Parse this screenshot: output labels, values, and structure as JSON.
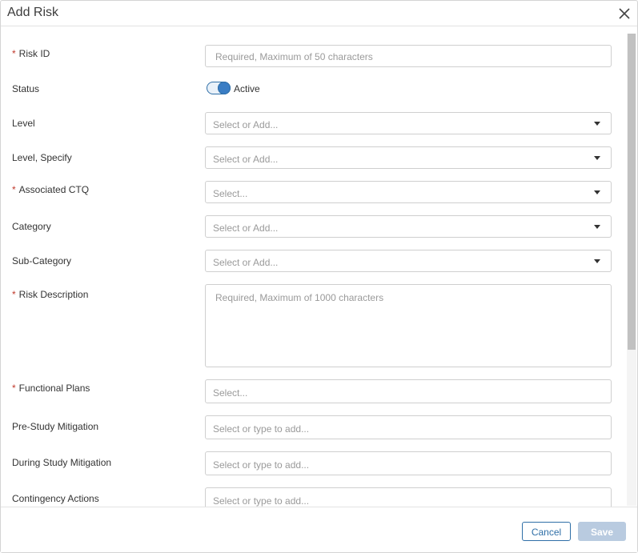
{
  "dialog": {
    "title": "Add Risk"
  },
  "form": {
    "risk_id": {
      "label": "Risk ID",
      "placeholder": "Required, Maximum of 50 characters"
    },
    "status": {
      "label": "Status",
      "toggle_label": "Active",
      "active": true
    },
    "level": {
      "label": "Level",
      "placeholder": "Select or Add..."
    },
    "level_specify": {
      "label": "Level, Specify",
      "placeholder": "Select or Add..."
    },
    "associated_ctq": {
      "label": "Associated CTQ",
      "placeholder": "Select..."
    },
    "category": {
      "label": "Category",
      "placeholder": "Select or Add..."
    },
    "sub_category": {
      "label": "Sub-Category",
      "placeholder": "Select or Add..."
    },
    "risk_description": {
      "label": "Risk Description",
      "placeholder": "Required, Maximum of 1000 characters"
    },
    "functional_plans": {
      "label": "Functional Plans",
      "placeholder": "Select..."
    },
    "pre_study_mitigation": {
      "label": "Pre-Study Mitigation",
      "placeholder": "Select or type to add..."
    },
    "during_study_mitigation": {
      "label": "During Study Mitigation",
      "placeholder": "Select or type to add..."
    },
    "contingency_actions": {
      "label": "Contingency Actions",
      "placeholder": "Select or type to add..."
    },
    "required_marker": "*"
  },
  "footer": {
    "cancel_label": "Cancel",
    "save_label": "Save"
  },
  "icons": {
    "close": "close-icon",
    "dropdown": "chevron-down-icon"
  },
  "colors": {
    "accent": "#2f6fa7",
    "required": "#c0392b",
    "save_disabled": "#b9cbe0"
  }
}
